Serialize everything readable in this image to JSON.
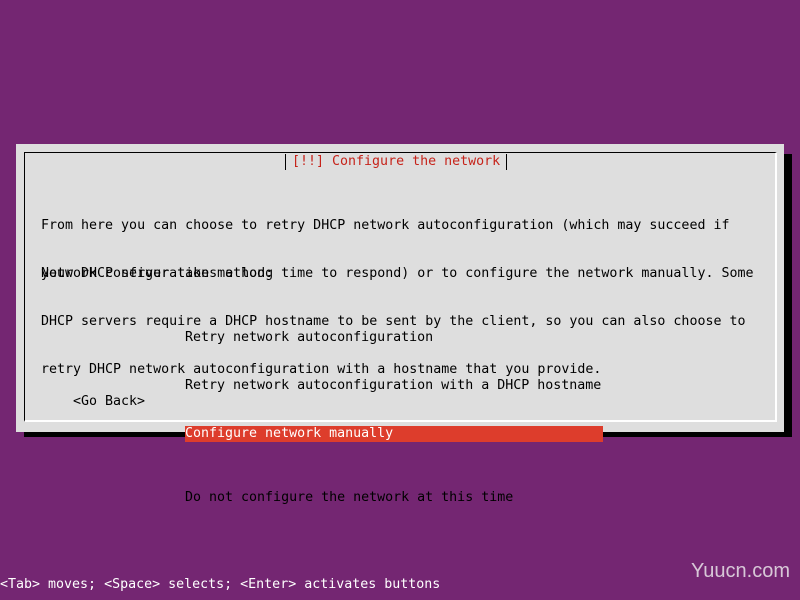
{
  "dialog": {
    "title": "[!!] Configure the network",
    "description_lines": [
      "From here you can choose to retry DHCP network autoconfiguration (which may succeed if",
      "your DHCP server takes a long time to respond) or to configure the network manually. Some",
      "DHCP servers require a DHCP hostname to be sent by the client, so you can also choose to",
      "retry DHCP network autoconfiguration with a hostname that you provide."
    ],
    "method_label": "Network configuration method:",
    "options": [
      "Retry network autoconfiguration",
      "Retry network autoconfiguration with a DHCP hostname",
      "Configure network manually",
      "Do not configure the network at this time"
    ],
    "selected_option": "Configure network manually",
    "go_back_label": "<Go Back>"
  },
  "help_line": "<Tab> moves; <Space> selects; <Enter> activates buttons",
  "watermark": "Yuucn.com",
  "colors": {
    "background": "#742672",
    "dialog_bg": "#dedede",
    "title_text": "#c6231a",
    "selection_bg": "#dd3d2c",
    "selection_text": "#ffffff"
  }
}
